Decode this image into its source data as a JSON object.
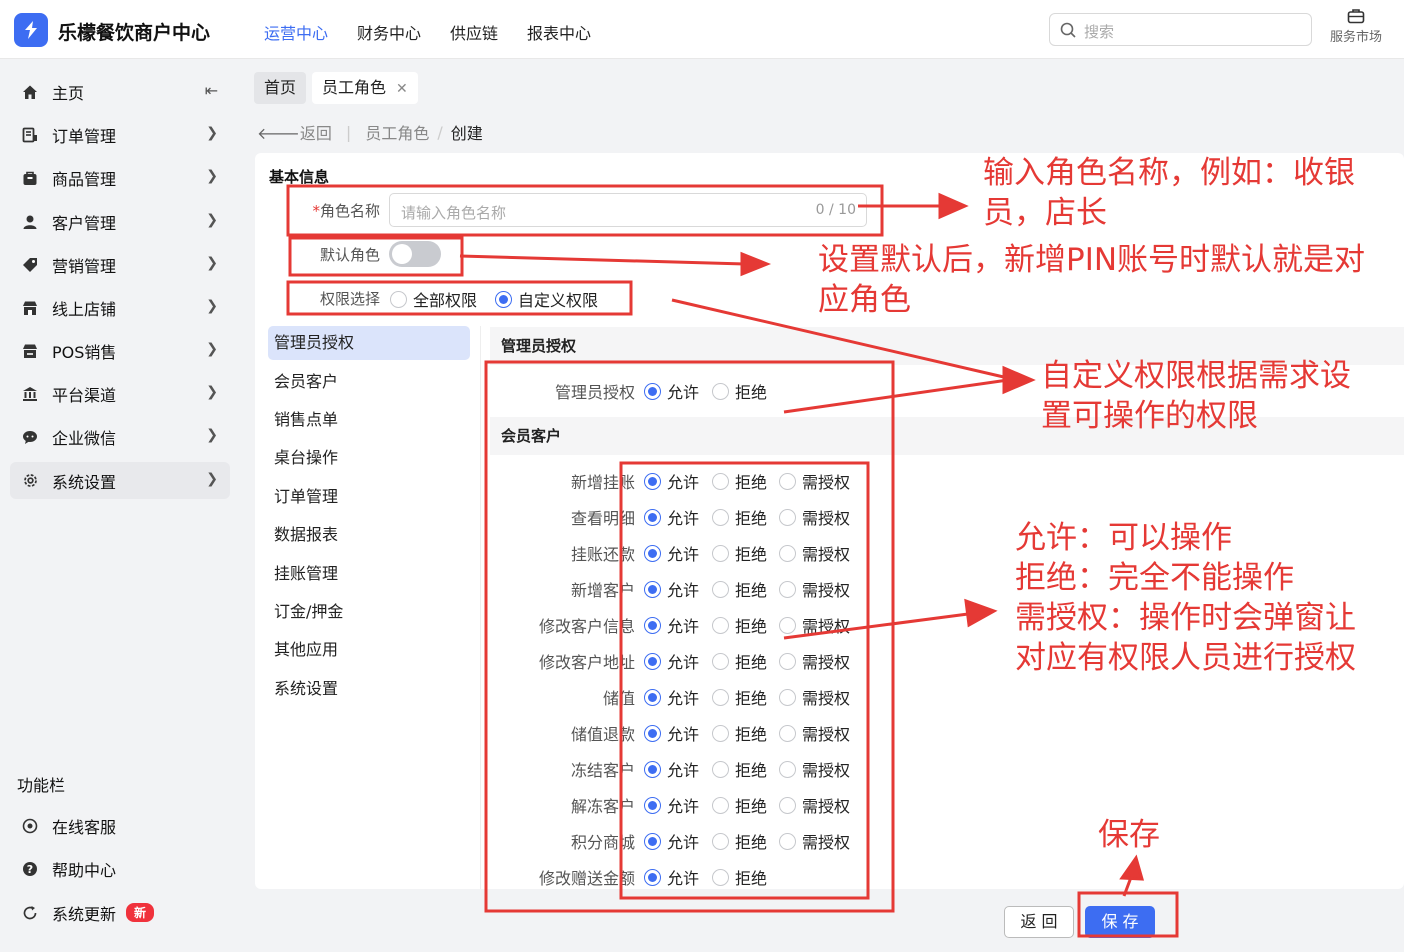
{
  "header": {
    "brand": "乐檬餐饮商户中心",
    "nav": [
      "运营中心",
      "财务中心",
      "供应链",
      "报表中心"
    ],
    "active_nav": 0,
    "search_placeholder": "搜索",
    "service_market": "服务市场"
  },
  "sidebar": {
    "items": [
      {
        "label": "主页",
        "icon": "home-icon",
        "collapse": true
      },
      {
        "label": "订单管理",
        "icon": "order-icon"
      },
      {
        "label": "商品管理",
        "icon": "goods-icon"
      },
      {
        "label": "客户管理",
        "icon": "customer-icon"
      },
      {
        "label": "营销管理",
        "icon": "tag-icon"
      },
      {
        "label": "线上店铺",
        "icon": "store-icon"
      },
      {
        "label": "POS销售",
        "icon": "pos-icon"
      },
      {
        "label": "平台渠道",
        "icon": "bank-icon"
      },
      {
        "label": "企业微信",
        "icon": "wechat-icon"
      },
      {
        "label": "系统设置",
        "icon": "gear-icon",
        "selected": true
      }
    ],
    "func_title": "功能栏",
    "func_items": [
      {
        "label": "在线客服",
        "icon": "headset-icon"
      },
      {
        "label": "帮助中心",
        "icon": "help-icon"
      },
      {
        "label": "系统更新",
        "icon": "refresh-icon",
        "badge": "新"
      }
    ]
  },
  "tabs": [
    {
      "label": "首页"
    },
    {
      "label": "员工角色",
      "closable": true,
      "current": true
    }
  ],
  "breadcrumb": {
    "back": "返回",
    "parent": "员工角色",
    "sep": "/",
    "current": "创建"
  },
  "form": {
    "section_title": "基本信息",
    "required_mark": "*",
    "name_label": "角色名称",
    "name_placeholder": "请输入角色名称",
    "name_count": "0 / 10",
    "default_label": "默认角色",
    "default_on": false,
    "perm_label": "权限选择",
    "perm_options": [
      "全部权限",
      "自定义权限"
    ],
    "perm_selected": 1
  },
  "perm_nav": {
    "items": [
      "管理员授权",
      "会员客户",
      "销售点单",
      "桌台操作",
      "订单管理",
      "数据报表",
      "挂账管理",
      "订金/押金",
      "其他应用",
      "系统设置"
    ],
    "selected": 0
  },
  "perm_sections": [
    {
      "title": "管理员授权",
      "rows": [
        {
          "label": "管理员授权",
          "options": [
            "允许",
            "拒绝"
          ],
          "selected": 0
        }
      ]
    },
    {
      "title": "会员客户",
      "rows": [
        {
          "label": "新增挂账",
          "options": [
            "允许",
            "拒绝",
            "需授权"
          ],
          "selected": 0
        },
        {
          "label": "查看明细",
          "options": [
            "允许",
            "拒绝",
            "需授权"
          ],
          "selected": 0
        },
        {
          "label": "挂账还款",
          "options": [
            "允许",
            "拒绝",
            "需授权"
          ],
          "selected": 0
        },
        {
          "label": "新增客户",
          "options": [
            "允许",
            "拒绝",
            "需授权"
          ],
          "selected": 0
        },
        {
          "label": "修改客户信息",
          "options": [
            "允许",
            "拒绝",
            "需授权"
          ],
          "selected": 0
        },
        {
          "label": "修改客户地址",
          "options": [
            "允许",
            "拒绝",
            "需授权"
          ],
          "selected": 0
        },
        {
          "label": "储值",
          "options": [
            "允许",
            "拒绝",
            "需授权"
          ],
          "selected": 0
        },
        {
          "label": "储值退款",
          "options": [
            "允许",
            "拒绝",
            "需授权"
          ],
          "selected": 0
        },
        {
          "label": "冻结客户",
          "options": [
            "允许",
            "拒绝",
            "需授权"
          ],
          "selected": 0
        },
        {
          "label": "解冻客户",
          "options": [
            "允许",
            "拒绝",
            "需授权"
          ],
          "selected": 0
        },
        {
          "label": "积分商城",
          "options": [
            "允许",
            "拒绝",
            "需授权"
          ],
          "selected": 0
        },
        {
          "label": "修改赠送金额",
          "options": [
            "允许",
            "拒绝"
          ],
          "selected": 0
        }
      ]
    }
  ],
  "footer": {
    "back": "返 回",
    "save": "保 存"
  },
  "annotations": {
    "name_hint": [
      "输入角色名称，例如：收银",
      "员，店长"
    ],
    "default_hint": [
      "设置默认后，新增PIN账号时默认就是对",
      "应角色"
    ],
    "custom_hint": [
      "自定义权限根据需求设",
      "置可操作的权限"
    ],
    "option_hint": [
      "允许：可以操作",
      "拒绝：完全不能操作",
      "需授权：操作时会弹窗让",
      "对应有权限人员进行授权"
    ],
    "save_hint": "保存",
    "color": "#e53935"
  }
}
